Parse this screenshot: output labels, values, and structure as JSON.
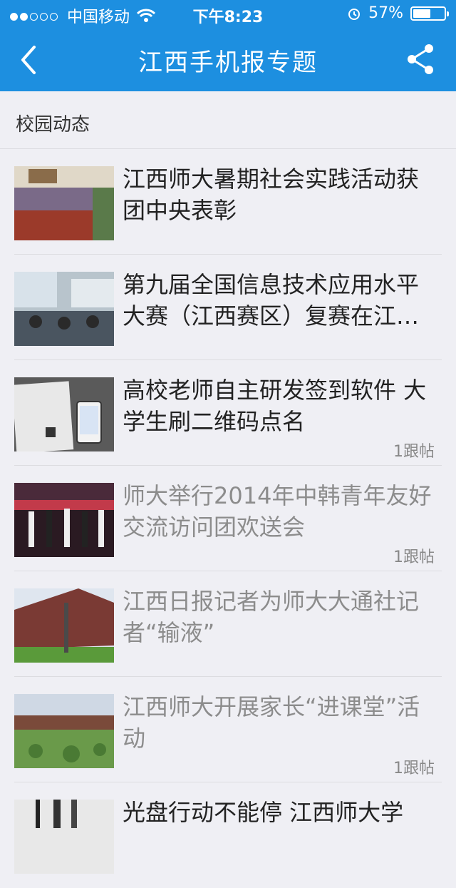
{
  "status_bar": {
    "carrier": "中国移动",
    "time": "下午8:23",
    "battery": "57%",
    "battery_level": 0.57
  },
  "nav": {
    "title": "江西手机报专题",
    "back_icon": "chevron-left-icon",
    "share_icon": "share-icon"
  },
  "section": {
    "title": "校园动态"
  },
  "articles": [
    {
      "title": "江西师大暑期社会实践活动获团中央表彰",
      "comments": "",
      "read": false
    },
    {
      "title": "第九届全国信息技术应用水平大赛（江西赛区）复赛在江…",
      "comments": "",
      "read": false
    },
    {
      "title": "高校老师自主研发签到软件 大学生刷二维码点名",
      "comments": "1跟帖",
      "read": false
    },
    {
      "title": "师大举行2014年中韩青年友好交流访问团欢送会",
      "comments": "1跟帖",
      "read": true
    },
    {
      "title": "江西日报记者为师大大通社记者“输液”",
      "comments": "",
      "read": true
    },
    {
      "title": "江西师大开展家长“进课堂”活动",
      "comments": "1跟帖",
      "read": true
    },
    {
      "title": "光盘行动不能停 江西师大学",
      "comments": "",
      "read": false
    }
  ],
  "colors": {
    "header": "#1d8fe0",
    "background": "#efeff4"
  }
}
